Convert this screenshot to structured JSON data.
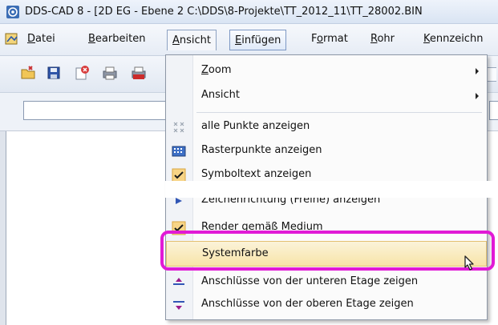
{
  "window": {
    "title": "DDS-CAD 8 - [2D  EG - Ebene 2  C:\\DDS\\8-Projekte\\TT_2012_11\\TT_28002.BIN"
  },
  "menubar": {
    "items": [
      {
        "label": "Datei",
        "accel": "D",
        "rest": "atei"
      },
      {
        "label": "Bearbeiten",
        "accel": "B",
        "rest": "earbeiten"
      },
      {
        "label": "Ansicht",
        "accel": "A",
        "rest": "nsicht"
      },
      {
        "label": "Einfügen",
        "accel": "E",
        "rest": "infügen"
      },
      {
        "label": "Format",
        "accel": "o",
        "pre": "F",
        "rest": "rmat"
      },
      {
        "label": "Rohr",
        "accel": "R",
        "rest": "ohr"
      },
      {
        "label": "Kennzeichn",
        "accel": "K",
        "rest": "ennzeichn"
      }
    ]
  },
  "toolbar": {
    "buttons": [
      "open-icon",
      "save-icon",
      "close-document-icon",
      "print-icon",
      "print-pdf-icon"
    ]
  },
  "dropdown": {
    "items": [
      {
        "label": "Zoom",
        "accel": "Z",
        "rest": "oom",
        "submenu": true
      },
      {
        "label": "Ansicht",
        "submenu": true
      },
      {
        "label": "alle Punkte anzeigen",
        "icon": "points-icon"
      },
      {
        "label": "Rasterpunkte anzeigen",
        "icon": "grid-points-icon"
      },
      {
        "label": "Symboltext anzeigen",
        "icon": "checkmark-icon"
      },
      {
        "label": "Zeichenrichtung (Freihe) anzeigen",
        "icon": "direction-arrow-icon"
      },
      {
        "label": "Render gemäß Medium",
        "icon": "checkmark-icon"
      },
      {
        "label": "Systemfarbe"
      },
      {
        "label": "Anschlüsse von der unteren Etage zeigen",
        "icon": "lower-floor-icon"
      },
      {
        "label": "Anschlüsse von der oberen Etage zeigen",
        "icon": "upper-floor-icon"
      }
    ]
  },
  "colors": {
    "highlight_frame": "#e11ad6",
    "selected_item": "#f8e4a8",
    "check_orange": "#e2901e"
  }
}
